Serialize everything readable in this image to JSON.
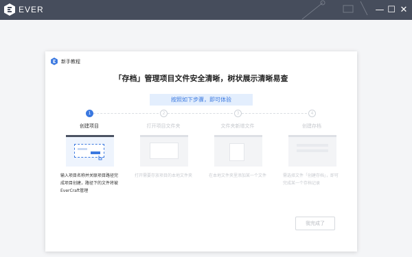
{
  "app": {
    "name": "EVER"
  },
  "window_controls": {
    "minimize": "—",
    "maximize": "☐",
    "close": "✕"
  },
  "dialog": {
    "title": "新手教程",
    "headline": "「存档」管理项目文件安全清晰，树状展示清晰易查",
    "sub_banner": "按照如下步骤，即可体验",
    "steps": [
      {
        "number": "1",
        "label": "创建项目",
        "description": "输入项目名称并关联项目路径完成项目创建，路径下的文件将被EverCraft管理"
      },
      {
        "number": "2",
        "label": "打开项目文件夹",
        "description": "打开需要存放项目的本地文件夹"
      },
      {
        "number": "3",
        "label": "文件夹新增文件",
        "description": "在本地文件夹里添加某一个文件"
      },
      {
        "number": "4",
        "label": "创建存档",
        "description": "需选择文件「创建存档」，即可完成某一个存档记录"
      }
    ],
    "done_button": "我完成了"
  },
  "colors": {
    "titlebar": "#464d5c",
    "accent": "#3a78e0",
    "banner_bg": "#e3eefd"
  }
}
